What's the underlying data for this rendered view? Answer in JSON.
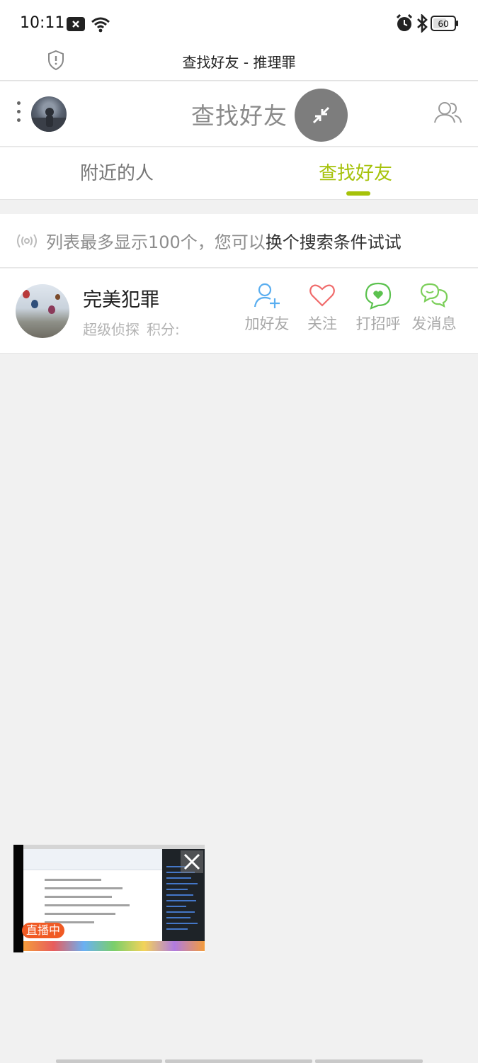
{
  "status_bar": {
    "time": "10:11",
    "battery": "60"
  },
  "browser": {
    "title": "查找好友 - 推理罪"
  },
  "header": {
    "title": "查找好友"
  },
  "tabs": [
    {
      "label": "附近的人",
      "active": false
    },
    {
      "label": "查找好友",
      "active": true
    }
  ],
  "notice": {
    "text": "列表最多显示100个，您可以",
    "link": "换个搜索条件试试"
  },
  "users": [
    {
      "name": "完美犯罪",
      "rank": "超级侦探",
      "score_label": "积分:",
      "actions": [
        {
          "label": "加好友",
          "icon": "add-friend-icon",
          "color": "#5aaef0"
        },
        {
          "label": "关注",
          "icon": "heart-icon",
          "color": "#f06b6b"
        },
        {
          "label": "打招呼",
          "icon": "greet-bubble-icon",
          "color": "#5cc24f"
        },
        {
          "label": "发消息",
          "icon": "chat-bubbles-icon",
          "color": "#7ccf5a"
        }
      ]
    }
  ],
  "live": {
    "badge": "直播中"
  },
  "colors": {
    "accent": "#a6c20a",
    "background": "#f1f1f1"
  }
}
